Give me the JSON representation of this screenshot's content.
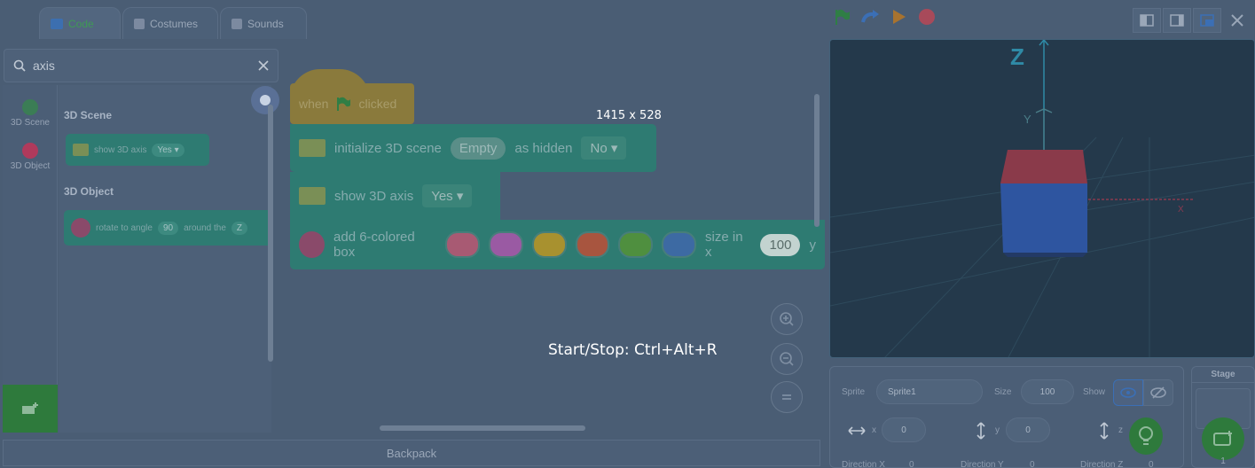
{
  "tabs": [
    {
      "label": "Code",
      "selected": true,
      "icon": "code-icon"
    },
    {
      "label": "Costumes",
      "selected": false,
      "icon": "brush-icon"
    },
    {
      "label": "Sounds",
      "selected": false,
      "icon": "speaker-icon"
    }
  ],
  "controls": {
    "green_flag": "green-flag-icon",
    "redo": "redo-icon",
    "turbo": "turbo-icon",
    "stop": "stop-icon"
  },
  "search": {
    "value": "axis"
  },
  "categories": [
    {
      "label": "3D Scene",
      "color": "#3b7d55"
    },
    {
      "label": "3D Object",
      "color": "#b03a5c"
    }
  ],
  "palette": {
    "section_scene": "3D Scene",
    "section_object": "3D Object",
    "show_axis": {
      "label": "show 3D axis",
      "value": "Yes"
    },
    "rotate": {
      "label": "rotate to angle",
      "angle": "90",
      "around": "around the",
      "axis": "Z"
    }
  },
  "workspace": {
    "hat": {
      "when": "when",
      "clicked": "clicked"
    },
    "init": {
      "label": "initialize 3D scene",
      "scene": "Empty",
      "as_hidden": "as hidden",
      "hidden_value": "No"
    },
    "show_axis": {
      "label": "show 3D axis",
      "value": "Yes"
    },
    "box": {
      "label": "add 6-colored box",
      "size_label": "size in x",
      "size": "100",
      "trailing": "y",
      "colors": [
        "#a85a73",
        "#9a5aa3",
        "#a8912f",
        "#a8553f",
        "#4f8f3f",
        "#3d6aa3"
      ]
    }
  },
  "overlay": {
    "size": "1415 x 528",
    "shortcut": "Start/Stop: Ctrl+Alt+R"
  },
  "backpack": "Backpack",
  "stage_view": {
    "z_label": "Z",
    "y_label": "Y",
    "x_label": "X"
  },
  "sprite": {
    "sprite_label": "Sprite",
    "sprite_name": "Sprite1",
    "size_label": "Size",
    "size_value": "100",
    "show_label": "Show",
    "x_label": "x",
    "x_value": "0",
    "y_label": "y",
    "y_value": "0",
    "z_label": "z",
    "dir_x": "Direction X",
    "dir_x_value": "0",
    "dir_y": "Direction Y",
    "dir_y_value": "0",
    "dir_z": "Direction Z",
    "dir_z_value": "0"
  },
  "stage_pane": {
    "label": "Stage",
    "backdrops": "1"
  }
}
